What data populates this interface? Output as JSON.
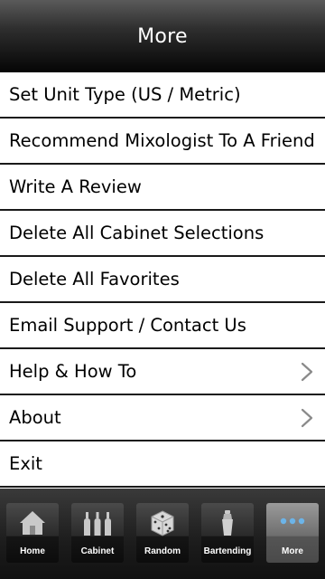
{
  "header": {
    "title": "More"
  },
  "menu": {
    "items": [
      {
        "label": "Set Unit Type (US / Metric)"
      },
      {
        "label": "Recommend Mixologist To A Friend"
      },
      {
        "label": "Write A Review"
      },
      {
        "label": "Delete All Cabinet Selections"
      },
      {
        "label": "Delete All Favorites"
      },
      {
        "label": "Email Support / Contact Us"
      },
      {
        "label": "Help & How To",
        "icon": "chevron-right-icon"
      },
      {
        "label": "About",
        "icon": "chevron-right-icon"
      },
      {
        "label": "Exit"
      }
    ]
  },
  "tabbar": {
    "tabs": [
      {
        "label": "Home",
        "icon": "home-icon"
      },
      {
        "label": "Cabinet",
        "icon": "bottles-icon"
      },
      {
        "label": "Random",
        "icon": "dice-icon"
      },
      {
        "label": "Bartending",
        "icon": "shaker-icon"
      },
      {
        "label": "More",
        "icon": "more-dots-icon",
        "selected": true
      }
    ]
  },
  "colors": {
    "accent": "#6cb4e8",
    "header_bg": "#1a1a1a",
    "divider": "#1a1a1a"
  }
}
